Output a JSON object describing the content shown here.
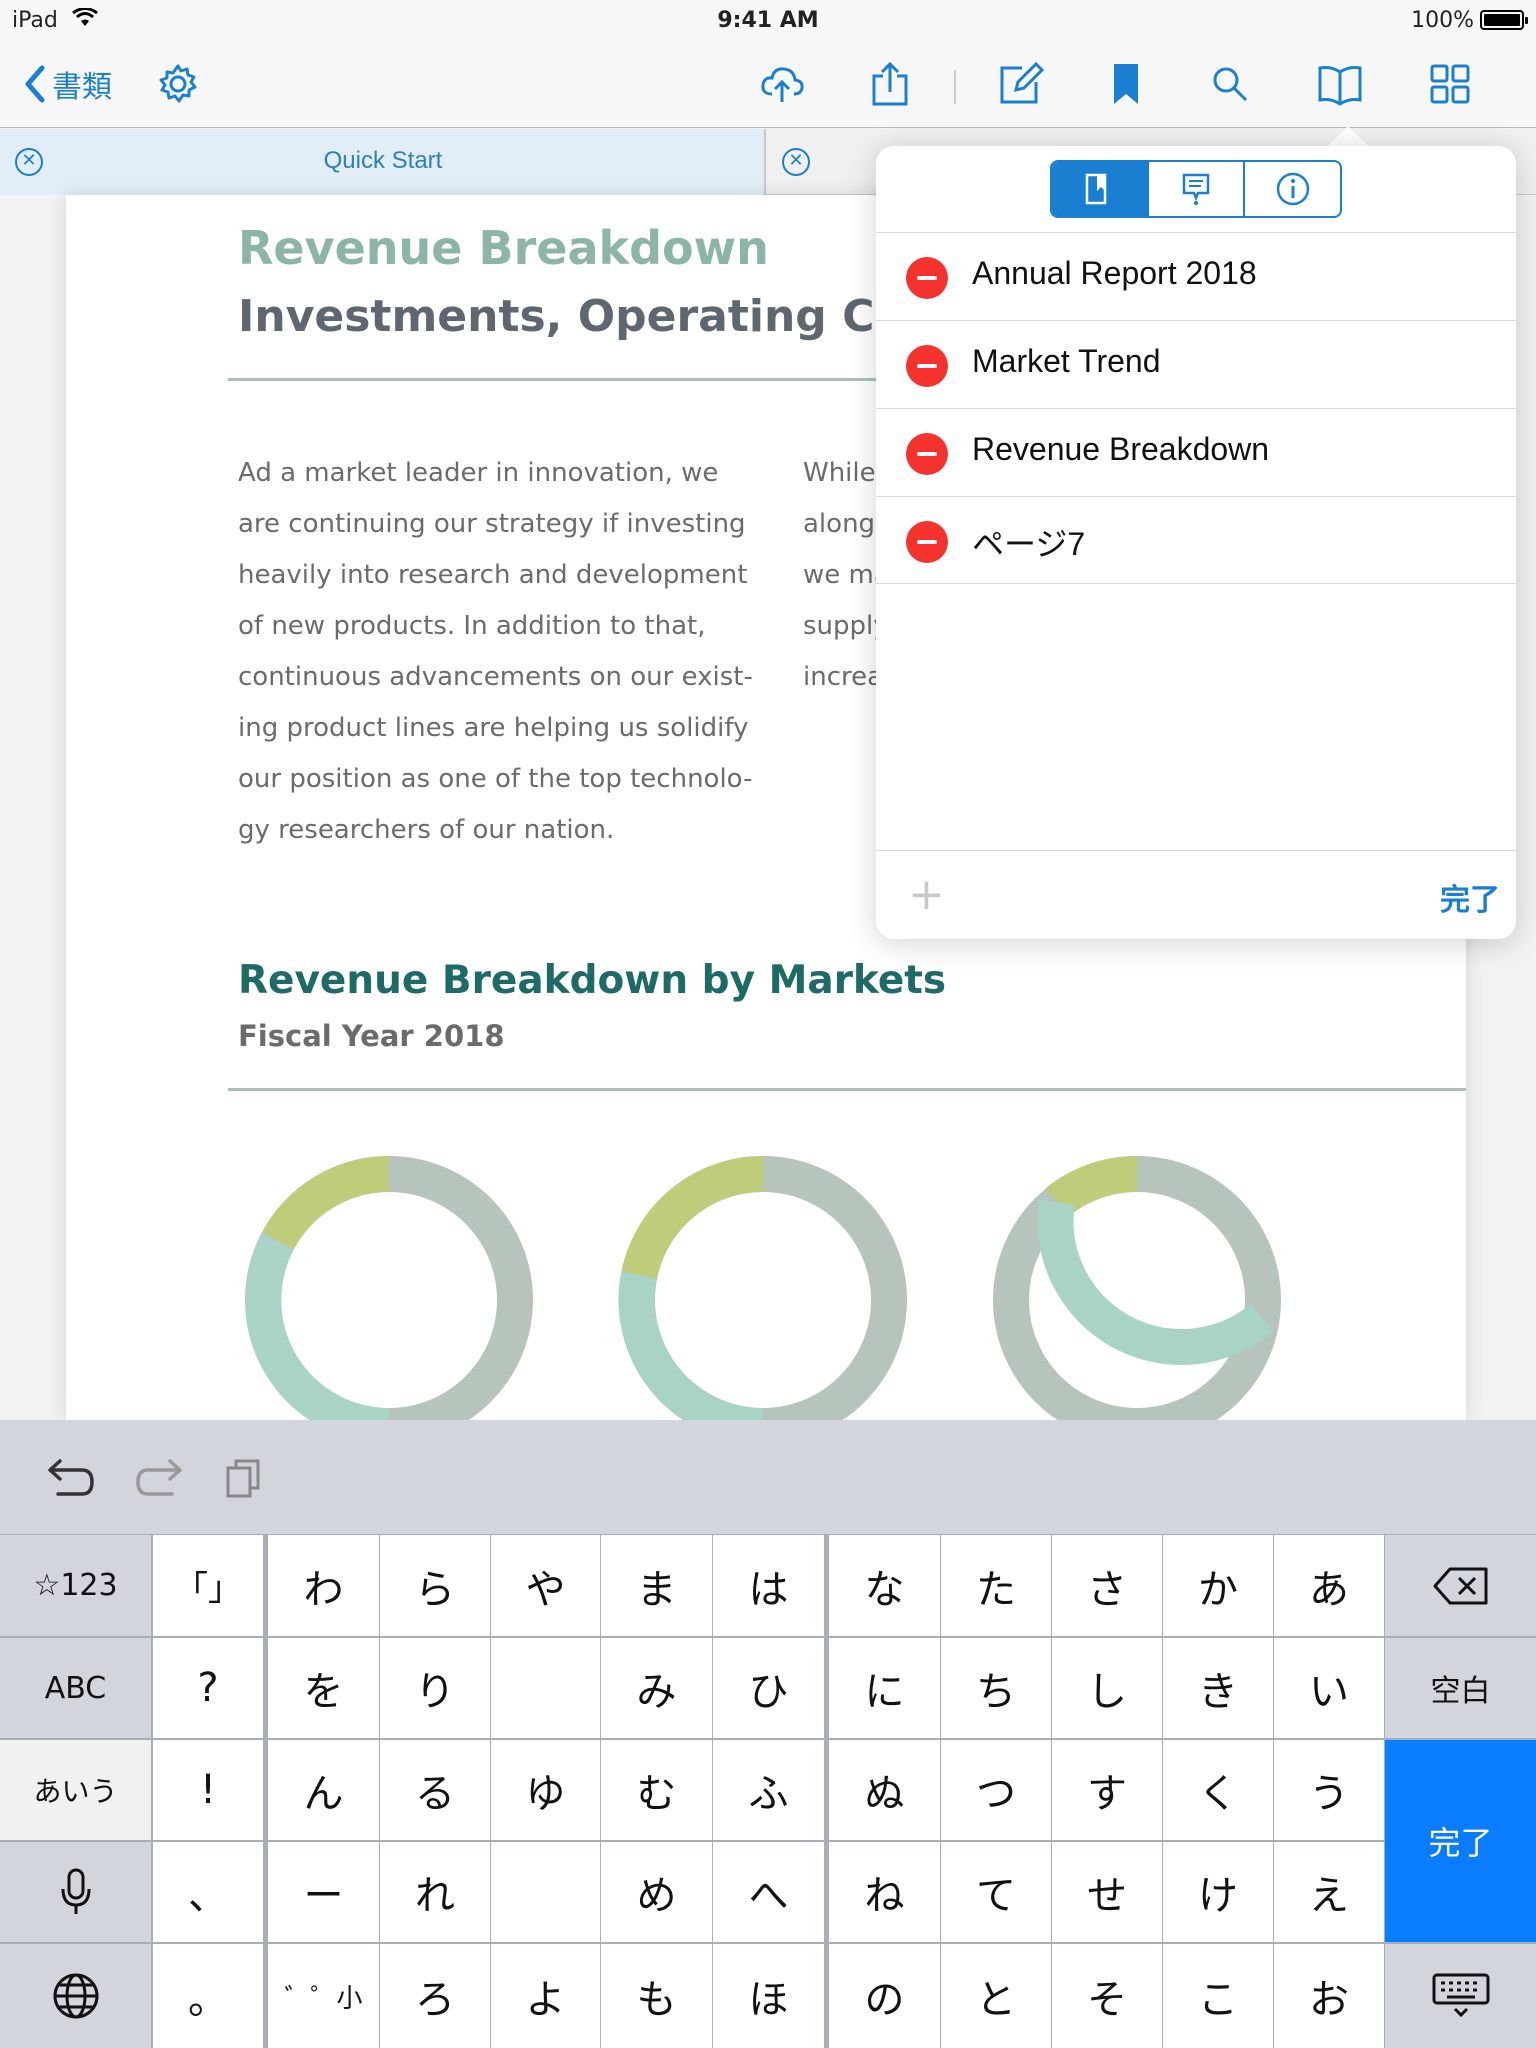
{
  "status": {
    "device": "iPad",
    "time": "9:41 AM",
    "battery": "100%"
  },
  "nav": {
    "back_label": "書類"
  },
  "tabs": [
    {
      "label": "Quick Start"
    }
  ],
  "doc": {
    "title": "Revenue Breakdown",
    "subtitle": "Investments, Operating Costs, F",
    "col1": [
      "Ad a market leader in innovation, we",
      "are continuing our strategy if investing",
      "heavily into research and development",
      "of new products. In addition to that,",
      "continuous advancements on our exist-",
      "ing product lines are helping us solidify",
      "our position as one of the top technolo-",
      "gy researchers of our nation."
    ],
    "col2": [
      "While",
      "alongs",
      "we ma",
      "supply",
      "increa"
    ],
    "section_title": "Revenue Breakdown by Markets",
    "section_sub": "Fiscal Year 2018"
  },
  "popover": {
    "items": [
      {
        "label": "Annual Report 2018"
      },
      {
        "label": "Market Trend"
      },
      {
        "label": "Revenue Breakdown"
      },
      {
        "label": "ページ7"
      }
    ],
    "done_label": "完了",
    "add_label": "+"
  },
  "colors": {
    "accent": "#1b7fd1",
    "donut_gray": "#b6c4bb",
    "donut_teal": "#a9d3c6",
    "donut_green": "#bfcd7a",
    "delete_red": "#f4332e",
    "keyboard_blue": "#0a7cff"
  },
  "keyboard": {
    "left": [
      "☆123",
      "ABC",
      "あいう",
      "",
      ""
    ],
    "right": [
      "",
      "空白",
      "完了",
      "",
      ""
    ],
    "punct": [
      "「」",
      "?",
      "!",
      "、",
      "。"
    ],
    "grid": [
      [
        "わ",
        "ら",
        "や",
        "ま",
        "は",
        "な",
        "た",
        "さ",
        "か",
        "あ"
      ],
      [
        "を",
        "り",
        "",
        "み",
        "ひ",
        "に",
        "ち",
        "し",
        "き",
        "い"
      ],
      [
        "ん",
        "る",
        "ゆ",
        "む",
        "ふ",
        "ぬ",
        "つ",
        "す",
        "く",
        "う"
      ],
      [
        "ー",
        "れ",
        "",
        "め",
        "へ",
        "ね",
        "て",
        "せ",
        "け",
        "え"
      ],
      [
        "゛゜小",
        "ろ",
        "よ",
        "も",
        "ほ",
        "の",
        "と",
        "そ",
        "こ",
        "お"
      ]
    ]
  }
}
